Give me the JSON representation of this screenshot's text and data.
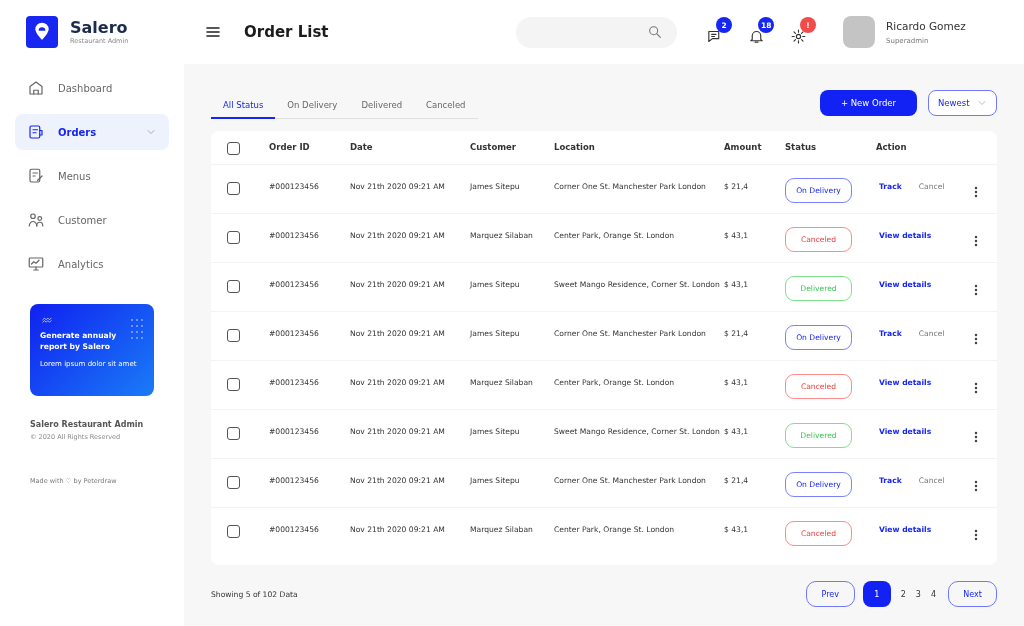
{
  "brand": {
    "name": "Salero",
    "subtitle": "Restaurant Admin"
  },
  "sidebar": {
    "items": [
      {
        "label": "Dashboard",
        "selected": false
      },
      {
        "label": "Orders",
        "selected": true,
        "expandable": true
      },
      {
        "label": "Menus",
        "selected": false
      },
      {
        "label": "Customer",
        "selected": false
      },
      {
        "label": "Analytics",
        "selected": false
      }
    ],
    "promo": {
      "title": "Generate annualy report by Salero",
      "text": "Lorem ipsum dolor sit amet"
    },
    "footer": {
      "title": "Salero Restaurant Admin",
      "copyright": "© 2020 All Rights Reserved",
      "credit": "Made with ♡ by Peterdraw"
    }
  },
  "header": {
    "title": "Order List",
    "notifications": [
      {
        "badge": "2",
        "color": "#1726f0"
      },
      {
        "badge": "18",
        "color": "#1726f0"
      },
      {
        "badge": "!",
        "color": "#f24b4b"
      }
    ],
    "user": {
      "name": "Ricardo Gomez",
      "role": "Superadmin"
    }
  },
  "tabs": [
    {
      "label": "All Status",
      "selected": true
    },
    {
      "label": "On Delivery",
      "selected": false
    },
    {
      "label": "Delivered",
      "selected": false
    },
    {
      "label": "Canceled",
      "selected": false
    }
  ],
  "new_order_button": "+ New Order",
  "sort": {
    "value": "Newest"
  },
  "table": {
    "select_all_checked": false,
    "columns": [
      "Order ID",
      "Date",
      "Customer",
      "Location",
      "Amount",
      "Status",
      "Action"
    ],
    "rows": [
      {
        "checked": false,
        "id": "#000123456",
        "date": "Nov 21th 2020 09:21 AM",
        "customer": "James Sitepu",
        "location": "Corner One St. Manchester Park London",
        "amount": "$ 21,4",
        "status": {
          "label": "On Delivery",
          "kind": "delivery"
        },
        "actions": [
          {
            "label": "Track",
            "kind": "primary"
          },
          {
            "label": "Cancel",
            "kind": "secondary"
          }
        ]
      },
      {
        "checked": false,
        "id": "#000123456",
        "date": "Nov 21th 2020 09:21 AM",
        "customer": "Marquez Silaban",
        "location": "Center Park, Orange St. London",
        "amount": "$ 43,1",
        "status": {
          "label": "Canceled",
          "kind": "canceled"
        },
        "actions": [
          {
            "label": "View details",
            "kind": "primary"
          }
        ]
      },
      {
        "checked": false,
        "id": "#000123456",
        "date": "Nov 21th 2020 09:21 AM",
        "customer": "James Sitepu",
        "location": "Sweet Mango Residence, Corner St. London",
        "amount": "$ 43,1",
        "status": {
          "label": "Delivered",
          "kind": "delivered"
        },
        "actions": [
          {
            "label": "View details",
            "kind": "primary"
          }
        ]
      },
      {
        "checked": false,
        "id": "#000123456",
        "date": "Nov 21th 2020 09:21 AM",
        "customer": "James Sitepu",
        "location": "Corner One St. Manchester Park London",
        "amount": "$ 21,4",
        "status": {
          "label": "On Delivery",
          "kind": "delivery"
        },
        "actions": [
          {
            "label": "Track",
            "kind": "primary"
          },
          {
            "label": "Cancel",
            "kind": "secondary"
          }
        ]
      },
      {
        "checked": false,
        "id": "#000123456",
        "date": "Nov 21th 2020 09:21 AM",
        "customer": "Marquez Silaban",
        "location": "Center Park, Orange St. London",
        "amount": "$ 43,1",
        "status": {
          "label": "Canceled",
          "kind": "canceled"
        },
        "actions": [
          {
            "label": "View details",
            "kind": "primary"
          }
        ]
      },
      {
        "checked": false,
        "id": "#000123456",
        "date": "Nov 21th 2020 09:21 AM",
        "customer": "James Sitepu",
        "location": "Sweet Mango Residence, Corner St. London",
        "amount": "$ 43,1",
        "status": {
          "label": "Delivered",
          "kind": "delivered"
        },
        "actions": [
          {
            "label": "View details",
            "kind": "primary"
          }
        ]
      },
      {
        "checked": false,
        "id": "#000123456",
        "date": "Nov 21th 2020 09:21 AM",
        "customer": "James Sitepu",
        "location": "Corner One St. Manchester Park London",
        "amount": "$ 21,4",
        "status": {
          "label": "On Delivery",
          "kind": "delivery"
        },
        "actions": [
          {
            "label": "Track",
            "kind": "primary"
          },
          {
            "label": "Cancel",
            "kind": "secondary"
          }
        ]
      },
      {
        "checked": false,
        "id": "#000123456",
        "date": "Nov 21th 2020 09:21 AM",
        "customer": "Marquez Silaban",
        "location": "Center Park, Orange St. London",
        "amount": "$ 43,1",
        "status": {
          "label": "Canceled",
          "kind": "canceled"
        },
        "actions": [
          {
            "label": "View details",
            "kind": "primary"
          }
        ]
      }
    ]
  },
  "pagination": {
    "summary": "Showing 5 of 102 Data",
    "prev": "Prev",
    "next": "Next",
    "pages": [
      {
        "label": "1",
        "selected": true
      },
      {
        "label": "2",
        "selected": false
      },
      {
        "label": "3",
        "selected": false
      },
      {
        "label": "4",
        "selected": false
      }
    ]
  }
}
